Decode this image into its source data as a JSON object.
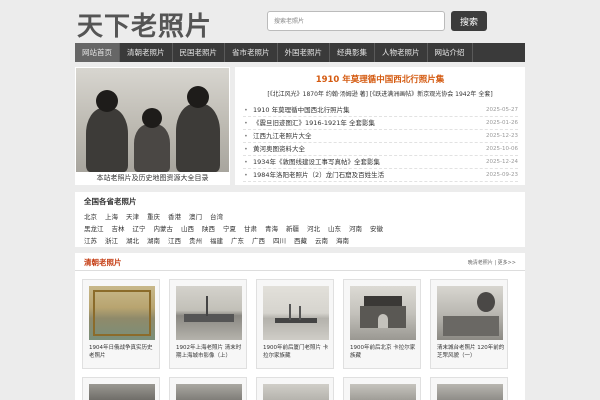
{
  "site": {
    "logo": "天下老照片",
    "search_placeholder": "搜索老照片",
    "search_button": "搜索"
  },
  "nav": {
    "items": [
      "网站首页",
      "清朝老照片",
      "民国老照片",
      "省市老照片",
      "外国老照片",
      "经典影集",
      "人物老照片",
      "网站介绍"
    ],
    "active_index": 0
  },
  "feature": {
    "caption": "本站老照片及历史地图资源大全目录"
  },
  "topnews": {
    "title": "1910 年莫理循中国西北行照片集",
    "subtitle": "[《北江风光》1870年 约翰·汤姆逊 著] [《跃进满洲画帖》新京观光协会 1942年 全套]",
    "items": [
      {
        "title": "1910 年莫理循中国西北行照片集",
        "date": "2025-05-27"
      },
      {
        "title": "《震旦旧迹图汇》1916-1921年 全套影集",
        "date": "2025-01-26"
      },
      {
        "title": "江西九江老照片大全",
        "date": "2025-12-23"
      },
      {
        "title": "黄河奥图资料大全",
        "date": "2025-10-06"
      },
      {
        "title": "1934年《敦图线建设工事写真帖》全套影集",
        "date": "2025-12-24"
      },
      {
        "title": "1984年洛阳老照片（2）龙门石窟及百姓生活",
        "date": "2025-09-23"
      }
    ]
  },
  "regions": {
    "title": "全国各省老照片",
    "rows": [
      [
        "北京",
        "上海",
        "天津",
        "重庆",
        "香港",
        "澳门",
        "台湾"
      ],
      [
        "黑龙江",
        "吉林",
        "辽宁",
        "内蒙古",
        "山西",
        "陕西",
        "宁夏",
        "甘肃",
        "青海",
        "新疆",
        "河北",
        "山东",
        "河南",
        "安徽"
      ],
      [
        "江苏",
        "浙江",
        "湖北",
        "湖南",
        "江西",
        "贵州",
        "福建",
        "广东",
        "广西",
        "四川",
        "西藏",
        "云南",
        "海南"
      ]
    ]
  },
  "qing": {
    "title": "清朝老照片",
    "more": "晚清老照片 | 更多>>",
    "cards": [
      {
        "caption": "1904年日俄战争真实历史老照片",
        "icon": "painting-photo"
      },
      {
        "caption": "1902年上海老照片 清末时期上海城市影像（上）",
        "icon": "harbor-photo"
      },
      {
        "caption": "1900年前后厦门老照片 卡拉尔家族藏",
        "icon": "ship-photo"
      },
      {
        "caption": "1900年前后北京 卡拉尔家族藏",
        "icon": "gate-photo"
      },
      {
        "caption": "清末城台老照片 120年前的芝罘风貌（一）",
        "icon": "street-photo"
      }
    ]
  },
  "colors": {
    "accent": "#d45a10",
    "nav_bg": "#3a3a3a",
    "section_red": "#c43a10"
  }
}
